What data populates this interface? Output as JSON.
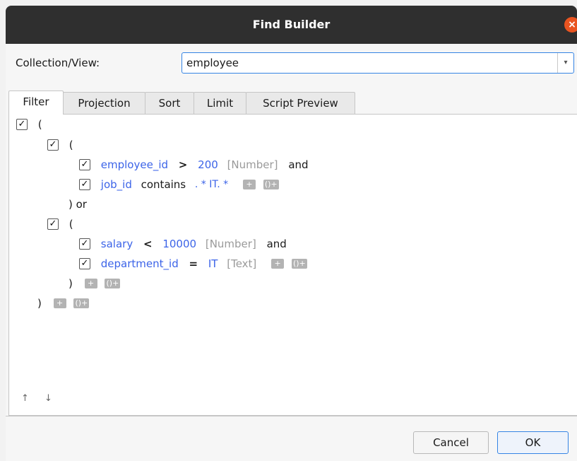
{
  "window": {
    "title": "Find Builder",
    "close_glyph": "×"
  },
  "collection": {
    "label": "Collection/View:",
    "value": "employee",
    "arrow": "▾"
  },
  "tabs": [
    {
      "label": "Filter"
    },
    {
      "label": "Projection"
    },
    {
      "label": "Sort"
    },
    {
      "label": "Limit"
    },
    {
      "label": "Script Preview"
    }
  ],
  "filter": {
    "check": "✓",
    "open_paren": "(",
    "group1": {
      "open": "(",
      "cond1": {
        "field": "employee_id",
        "op": ">",
        "value": "200",
        "type": "[Number]",
        "conj": "and"
      },
      "cond2": {
        "field": "job_id",
        "op": "contains",
        "value": ". * IT. *"
      },
      "close": ") or"
    },
    "group2": {
      "open": "(",
      "cond1": {
        "field": "salary",
        "op": "<",
        "value": "10000",
        "type": "[Number]",
        "conj": "and"
      },
      "cond2": {
        "field": "department_id",
        "op": "=",
        "value": "IT",
        "type": "[Text]"
      },
      "close": ")"
    },
    "close_paren": ")",
    "add_glyph": "+",
    "group_glyph": "()+"
  },
  "nav": {
    "up": "↑",
    "down": "↓"
  },
  "buttons": {
    "cancel": "Cancel",
    "ok": "OK"
  }
}
